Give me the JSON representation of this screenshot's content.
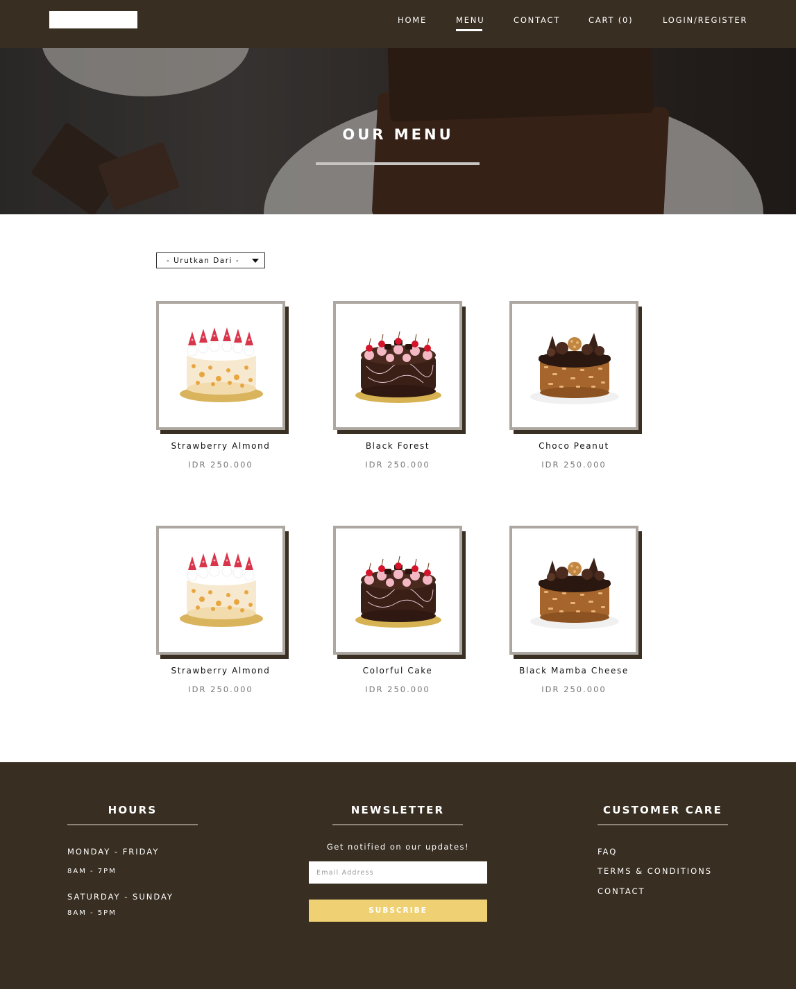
{
  "nav": {
    "items": [
      {
        "label": "HOME"
      },
      {
        "label": "MENU"
      },
      {
        "label": "CONTACT"
      },
      {
        "label": "CART (0)"
      },
      {
        "label": "LOGIN/REGISTER"
      }
    ],
    "active": "MENU"
  },
  "hero": {
    "title": "OUR MENU"
  },
  "sort": {
    "label": "- Urutkan Dari -"
  },
  "products": [
    {
      "name": "Strawberry Almond",
      "price": "IDR 250.000",
      "image_icon": "strawberry-almond-cake-icon"
    },
    {
      "name": "Black Forest",
      "price": "IDR 250.000",
      "image_icon": "black-forest-cake-icon"
    },
    {
      "name": "Choco Peanut",
      "price": "IDR 250.000",
      "image_icon": "choco-peanut-cake-icon"
    },
    {
      "name": "Strawberry Almond",
      "price": "IDR 250.000",
      "image_icon": "strawberry-almond-cake-icon"
    },
    {
      "name": "Colorful Cake",
      "price": "IDR 250.000",
      "image_icon": "black-forest-cake-icon"
    },
    {
      "name": "Black Mamba Cheese",
      "price": "IDR 250.000",
      "image_icon": "choco-peanut-cake-icon"
    }
  ],
  "footer": {
    "hours": {
      "title": "HOURS",
      "weekday_label": "MONDAY - FRIDAY",
      "weekday_time": "8AM - 7PM",
      "weekend_label": "SATURDAY - SUNDAY",
      "weekend_time": "8AM - 5PM"
    },
    "newsletter": {
      "title": "NEWSLETTER",
      "subtitle": "Get notified on our updates!",
      "email_placeholder": "Email Address",
      "subscribe_label": "SUBSCRIBE"
    },
    "customer_care": {
      "title": "CUSTOMER CARE",
      "links": [
        {
          "label": "FAQ"
        },
        {
          "label": "TERMS & CONDITIONS"
        },
        {
          "label": "CONTACT"
        }
      ]
    }
  },
  "colors": {
    "nav_bg": "#382e22",
    "footer_bg": "#382e22",
    "frame_gray": "#aca7a0",
    "subscribe_yellow": "#efd173"
  }
}
